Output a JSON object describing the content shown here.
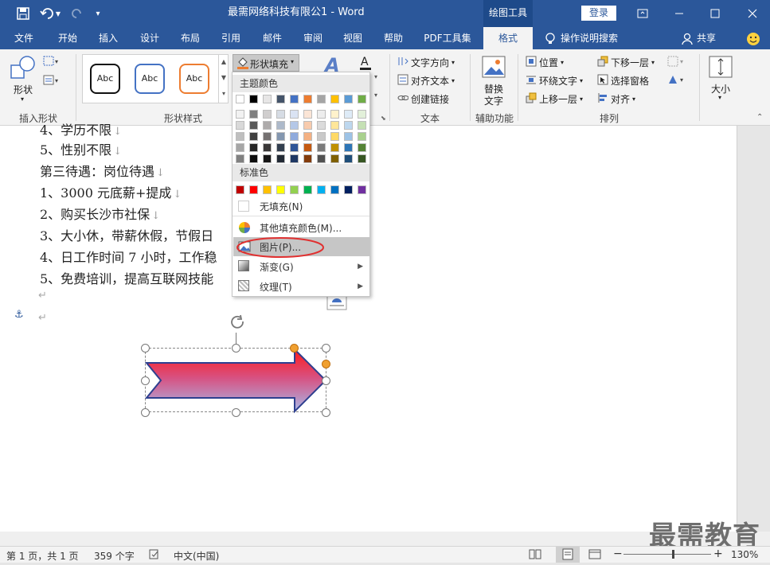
{
  "titlebar": {
    "doc_title": "最需网络科技有限公1 - Word",
    "tools_tab": "绘图工具",
    "login": "登录"
  },
  "tabs": [
    "文件",
    "开始",
    "插入",
    "设计",
    "布局",
    "引用",
    "邮件",
    "审阅",
    "视图",
    "帮助",
    "PDF工具集",
    "格式"
  ],
  "active_tab": "格式",
  "tell_me": "操作说明搜索",
  "share": "共享",
  "ribbon": {
    "groups": {
      "insert_shapes": "插入形状",
      "shape_styles": "形状样式",
      "text": "文本",
      "accessibility": "辅助功能",
      "arrange": "排列"
    },
    "shapes_label": "形状",
    "style_preview": "Abc",
    "shape_fill": "形状填充",
    "text_direction": "文字方向",
    "align_text": "对齐文本",
    "create_link": "创建链接",
    "alt_text_1": "替换",
    "alt_text_2": "文字",
    "position": "位置",
    "wrap_text": "环绕文字",
    "bring_forward": "上移一层",
    "send_backward": "下移一层",
    "selection_pane": "选择窗格",
    "align": "对齐",
    "size": "大小"
  },
  "document": {
    "lines": [
      "4、学历不限",
      "5、性别不限",
      "第三待遇：岗位待遇",
      "1、3000 元底薪+提成",
      "2、购买长沙市社保",
      "3、大小休，带薪休假，节假日",
      "4、日工作时间 7 小时，工作稳",
      "5、免费培训，提高互联网技能"
    ]
  },
  "fill_menu": {
    "theme_colors_header": "主题颜色",
    "standard_colors_header": "标准色",
    "no_fill": "无填充(N)",
    "more_colors": "其他填充颜色(M)...",
    "picture": "图片(P)...",
    "gradient": "渐变(G)",
    "texture": "纹理(T)",
    "theme_top_row": [
      "#ffffff",
      "#000000",
      "#e7e6e6",
      "#44546a",
      "#4472c4",
      "#ed7d31",
      "#a5a5a5",
      "#ffc000",
      "#5b9bd5",
      "#70ad47"
    ],
    "theme_columns": [
      [
        "#f2f2f2",
        "#d9d9d9",
        "#bfbfbf",
        "#a6a6a6",
        "#808080"
      ],
      [
        "#7f7f7f",
        "#595959",
        "#404040",
        "#262626",
        "#0d0d0d"
      ],
      [
        "#d0cece",
        "#aeabab",
        "#757171",
        "#3a3838",
        "#171616"
      ],
      [
        "#d6dce4",
        "#adb9ca",
        "#8497b0",
        "#333f4f",
        "#222a35"
      ],
      [
        "#dae3f3",
        "#b4c7e7",
        "#8faadc",
        "#2f5597",
        "#1f3864"
      ],
      [
        "#fbe5d6",
        "#f8cbad",
        "#f4b183",
        "#c55a11",
        "#843c0c"
      ],
      [
        "#ededed",
        "#dbdbdb",
        "#c9c9c9",
        "#7b7b7b",
        "#525252"
      ],
      [
        "#fff2cc",
        "#ffe699",
        "#ffd966",
        "#bf9000",
        "#7f6000"
      ],
      [
        "#deebf7",
        "#bdd7ee",
        "#9dc3e6",
        "#2e75b6",
        "#1f4e79"
      ],
      [
        "#e2f0d9",
        "#c5e0b4",
        "#a9d18e",
        "#548235",
        "#375623"
      ]
    ],
    "standard_colors": [
      "#c00000",
      "#ff0000",
      "#ffc000",
      "#ffff00",
      "#92d050",
      "#00b050",
      "#00b0f0",
      "#0070c0",
      "#002060",
      "#7030a0"
    ]
  },
  "statusbar": {
    "page": "第 1 页，共 1 页",
    "words": "359 个字",
    "language": "中文(中国)",
    "zoom": "130%"
  },
  "watermark": "最需教育",
  "colors": {
    "word_blue": "#2b579a",
    "highlight_red": "#e03030",
    "arrow_outline": "#2e3f8f"
  }
}
